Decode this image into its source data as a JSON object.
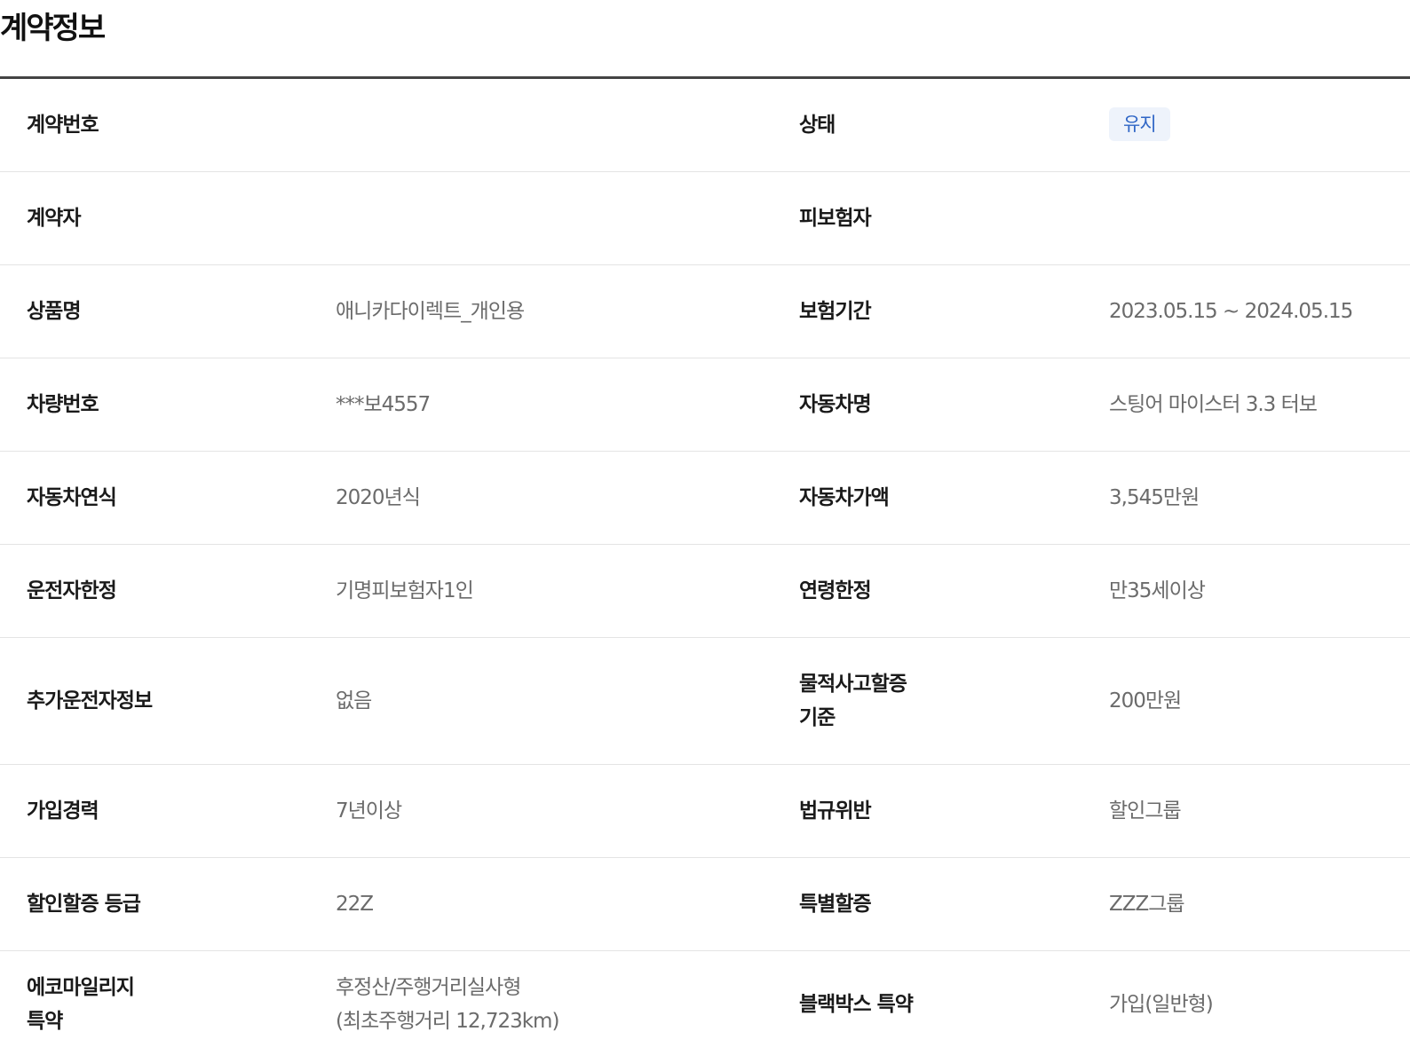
{
  "page": {
    "title": "계약정보"
  },
  "accent_colors": {
    "badge_bg": "#eef3fb",
    "badge_text": "#2f66c6"
  },
  "rows": [
    {
      "label_left": "계약번호",
      "value_left": "",
      "label_right": "상태",
      "value_right": "유지"
    },
    {
      "label_left": "계약자",
      "value_left": "",
      "label_right": "피보험자",
      "value_right": ""
    },
    {
      "label_left": "상품명",
      "value_left": "애니카다이렉트_개인용",
      "label_right": "보험기간",
      "value_right": "2023.05.15 ~ 2024.05.15"
    },
    {
      "label_left": "차량번호",
      "value_left": "***보4557",
      "label_right": "자동차명",
      "value_right": "스팅어 마이스터 3.3 터보"
    },
    {
      "label_left": "자동차연식",
      "value_left": "2020년식",
      "label_right": "자동차가액",
      "value_right": "3,545만원"
    },
    {
      "label_left": "운전자한정",
      "value_left": "기명피보험자1인",
      "label_right": "연령한정",
      "value_right": "만35세이상"
    },
    {
      "label_left": "추가운전자정보",
      "value_left": "없음",
      "label_right": "물적사고할증\n기준",
      "value_right": "200만원"
    },
    {
      "label_left": "가입경력",
      "value_left": "7년이상",
      "label_right": "법규위반",
      "value_right": "할인그룹"
    },
    {
      "label_left": "할인할증 등급",
      "value_left": "22Z",
      "label_right": "특별할증",
      "value_right": "ZZZ그룹"
    },
    {
      "label_left": "에코마일리지\n특약",
      "value_left": "후정산/주행거리실사형\n(최초주행거리 12,723km)",
      "label_right": "블랙박스 특약",
      "value_right": "가입(일반형)"
    }
  ]
}
